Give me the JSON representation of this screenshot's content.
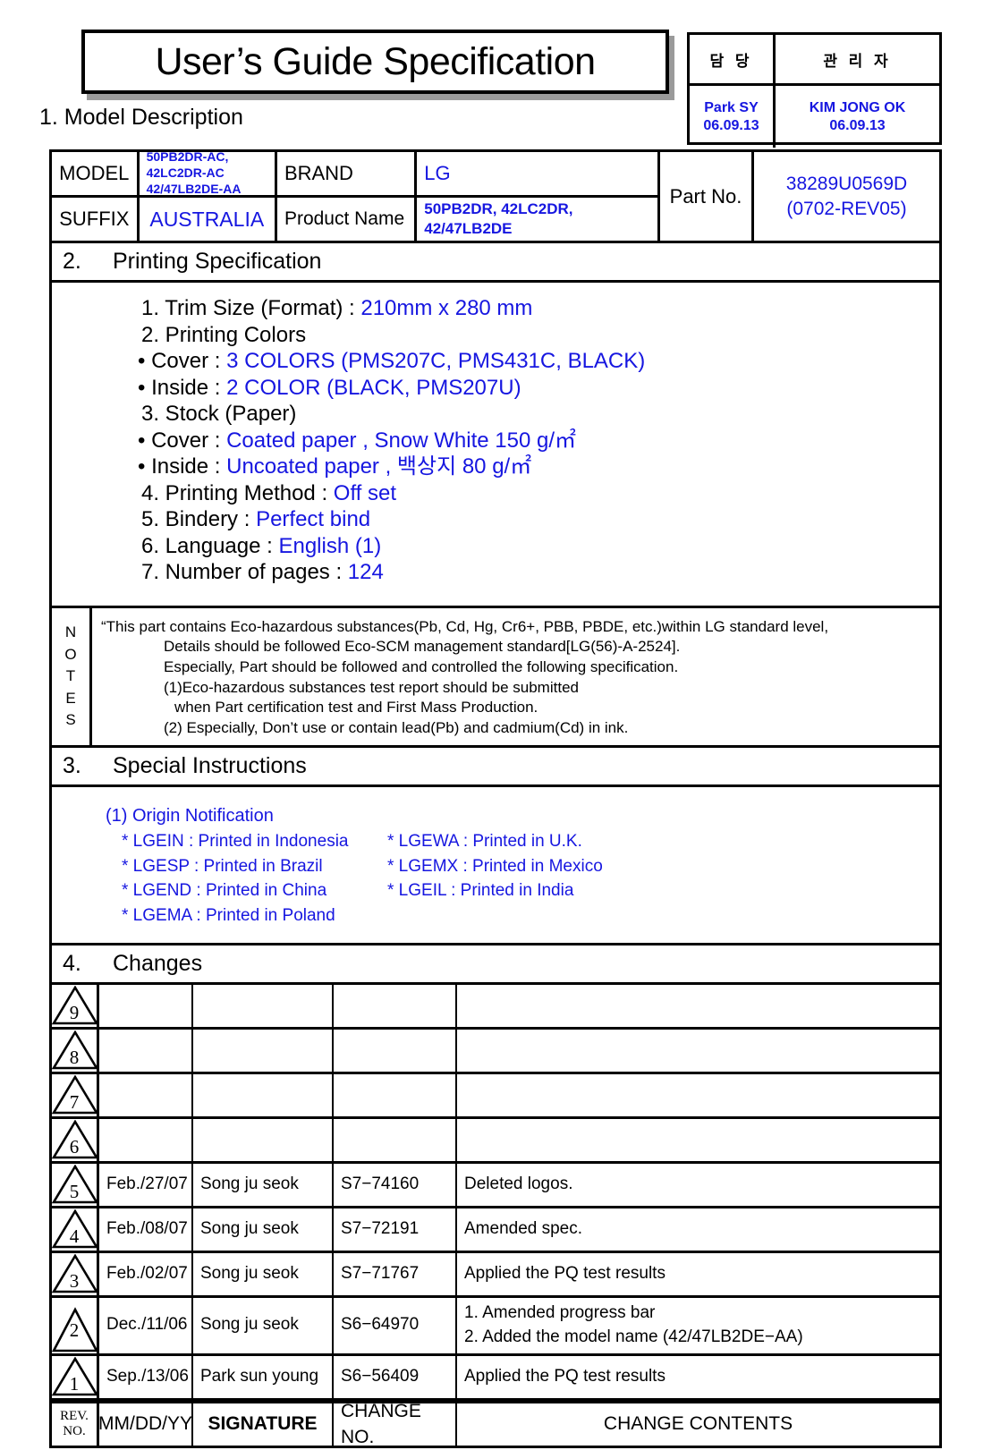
{
  "title": "User’s Guide Specification",
  "section1_heading": "1. Model Description",
  "approval": {
    "col1_header": "담  당",
    "col2_header": "관 리 자",
    "col1_name": "Park SY",
    "col1_date": "06.09.13",
    "col2_name": "KIM JONG OK",
    "col2_date": "06.09.13"
  },
  "model_table": {
    "model_label": "MODEL",
    "model_values": [
      "50PB2DR-AC,",
      "42LC2DR-AC",
      "42/47LB2DE-AA"
    ],
    "brand_label": "BRAND",
    "brand_value": "LG",
    "suffix_label": "SUFFIX",
    "suffix_value": "AUSTRALIA",
    "product_name_label": "Product Name",
    "product_name_values": [
      "50PB2DR, 42LC2DR,",
      "42/47LB2DE"
    ],
    "part_no_label": "Part No.",
    "part_no_values": [
      "38289U0569D",
      "(0702-REV05)"
    ]
  },
  "section2": {
    "number": "2.",
    "heading": "Printing Specification",
    "lines": [
      {
        "label": "1. Trim Size (Format) : ",
        "value": "210mm x 280 mm",
        "indent": "num"
      },
      {
        "label": "2. Printing Colors",
        "value": "",
        "indent": "num"
      },
      {
        "label": "• Cover : ",
        "value": "3 COLORS (PMS207C, PMS431C, BLACK)",
        "indent": "bullet"
      },
      {
        "label": "• Inside : ",
        "value": "2 COLOR (BLACK, PMS207U)",
        "indent": "bullet"
      },
      {
        "label": "3. Stock (Paper)",
        "value": "",
        "indent": "num"
      },
      {
        "label": "• Cover : ",
        "value": "Coated paper , Snow White 150 g/㎡",
        "indent": "bullet"
      },
      {
        "label": "• Inside : ",
        "value": "Uncoated paper , 백상지 80 g/㎡",
        "indent": "bullet"
      },
      {
        "label": "4. Printing Method : ",
        "value": "Off set",
        "indent": "num"
      },
      {
        "label": "5. Bindery  : ",
        "value": "Perfect bind",
        "indent": "num"
      },
      {
        "label": "6. Language : ",
        "value": "English (1)",
        "indent": "num"
      },
      {
        "label": "7. Number of pages : ",
        "value": "124",
        "indent": "num"
      }
    ]
  },
  "notes": {
    "label_letters": [
      "N",
      "O",
      "T",
      "E",
      "S"
    ],
    "lines": [
      {
        "text": "“This part contains Eco-hazardous substances(Pb, Cd, Hg, Cr6+, PBB, PBDE, etc.)within LG standard level,",
        "indent": "ind1"
      },
      {
        "text": "Details should be followed Eco-SCM management standard[LG(56)-A-2524].",
        "indent": "ind2"
      },
      {
        "text": "Especially, Part should be followed and controlled the following specification.",
        "indent": "ind2"
      },
      {
        "text": "(1)Eco-hazardous substances test report should be submitted",
        "indent": "ind2"
      },
      {
        "text": "when  Part certification test and First Mass Production.",
        "indent": "ind3"
      },
      {
        "text": "(2) Especially, Don’t use or contain lead(Pb) and cadmium(Cd) in ink.",
        "indent": "ind2"
      }
    ]
  },
  "section3": {
    "number": "3.",
    "heading": "Special Instructions",
    "subtitle": "(1) Origin Notification",
    "origins": [
      {
        "left": "* LGEIN : Printed in Indonesia",
        "right": "* LGEWA : Printed in U.K."
      },
      {
        "left": "* LGESP : Printed in Brazil",
        "right": "* LGEMX : Printed in Mexico"
      },
      {
        "left": "* LGEND : Printed in China",
        "right": " * LGEIL : Printed in India"
      },
      {
        "left": "* LGEMA : Printed in Poland",
        "right": ""
      }
    ]
  },
  "section4": {
    "number": "4.",
    "heading": "Changes",
    "rows": [
      {
        "rev": "9",
        "date": "",
        "signature": "",
        "change_no": "",
        "contents": [
          ""
        ]
      },
      {
        "rev": "8",
        "date": "",
        "signature": "",
        "change_no": "",
        "contents": [
          ""
        ]
      },
      {
        "rev": "7",
        "date": "",
        "signature": "",
        "change_no": "",
        "contents": [
          ""
        ]
      },
      {
        "rev": "6",
        "date": "",
        "signature": "",
        "change_no": "",
        "contents": [
          ""
        ]
      },
      {
        "rev": "5",
        "date": "Feb./27/07",
        "signature": "Song ju seok",
        "change_no": "S7−74160",
        "contents": [
          "Deleted logos."
        ]
      },
      {
        "rev": "4",
        "date": "Feb./08/07",
        "signature": "Song ju seok",
        "change_no": "S7−72191",
        "contents": [
          "Amended spec."
        ]
      },
      {
        "rev": "3",
        "date": "Feb./02/07",
        "signature": "Song ju seok",
        "change_no": "S7−71767",
        "contents": [
          "Applied the PQ test results"
        ]
      },
      {
        "rev": "2",
        "date": "Dec./11/06",
        "signature": "Song ju seok",
        "change_no": "S6−64970",
        "contents": [
          "1. Amended progress bar",
          "2. Added the model name (42/47LB2DE−AA)"
        ]
      },
      {
        "rev": "1",
        "date": "Sep./13/06",
        "signature": "Park sun young",
        "change_no": "S6−56409",
        "contents": [
          "Applied the PQ test results"
        ]
      }
    ],
    "header": {
      "rev_line1": "REV.",
      "rev_line2": "NO.",
      "date": "MM/DD/YY",
      "signature": "SIGNATURE",
      "change_no": "CHANGE NO.",
      "contents": "CHANGE   CONTENTS"
    }
  },
  "colors": {
    "blue": "#1616e0",
    "black": "#000000",
    "shadow": "#9a9a9a"
  }
}
